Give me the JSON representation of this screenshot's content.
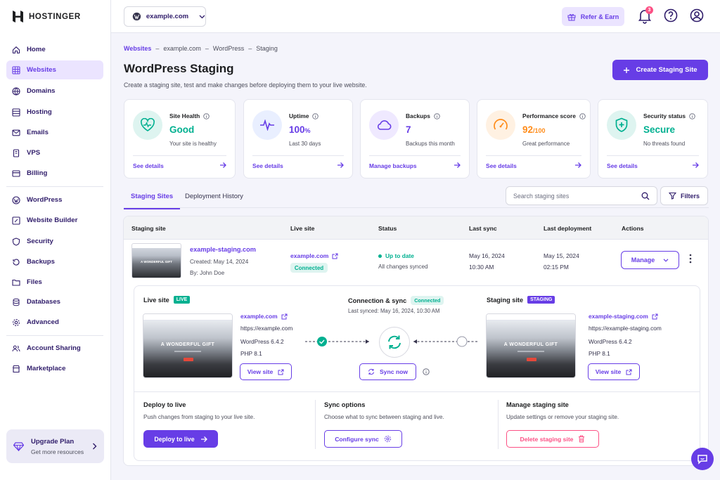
{
  "brand": {
    "name": "HOSTINGER"
  },
  "sidebar": {
    "items": [
      {
        "label": "Home",
        "icon": "home-icon"
      },
      {
        "label": "Websites",
        "icon": "websites-icon",
        "active": true
      },
      {
        "label": "Domains",
        "icon": "globe-icon"
      },
      {
        "label": "Hosting",
        "icon": "server-icon"
      },
      {
        "label": "Emails",
        "icon": "mail-icon"
      },
      {
        "label": "VPS",
        "icon": "vps-icon"
      },
      {
        "label": "Billing",
        "icon": "billing-icon"
      },
      {
        "label": "WordPress",
        "icon": "wordpress-icon"
      },
      {
        "label": "Website Builder",
        "icon": "builder-icon"
      },
      {
        "label": "Security",
        "icon": "shield-icon"
      },
      {
        "label": "Backups",
        "icon": "backup-icon"
      },
      {
        "label": "Files",
        "icon": "folder-icon"
      },
      {
        "label": "Databases",
        "icon": "database-icon"
      },
      {
        "label": "Advanced",
        "icon": "gear-icon"
      },
      {
        "label": "Account Sharing",
        "icon": "users-icon"
      },
      {
        "label": "Marketplace",
        "icon": "store-icon"
      }
    ],
    "upgrade": {
      "title": "Upgrade Plan",
      "subtitle": "Get more resources"
    }
  },
  "topbar": {
    "domain": "example.com",
    "refer_label": "Refer & Earn",
    "notification_count": "3"
  },
  "breadcrumb": {
    "root": "Websites",
    "domain": "example.com",
    "section": "WordPress",
    "page": "Staging",
    "separator": "–"
  },
  "page": {
    "title": "WordPress Staging",
    "subtitle": "Create a staging site, test and make changes before deploying them to your live website.",
    "create_button": "Create Staging Site"
  },
  "cards": [
    {
      "title": "Site Health",
      "value": "Good",
      "suffix": "",
      "sub": "Your site is healthy",
      "link": "See details",
      "color": "#00b090",
      "bg": "#def4f0"
    },
    {
      "title": "Uptime",
      "value": "100",
      "suffix": "%",
      "sub": "Last 30 days",
      "link": "See details",
      "color": "#673de6",
      "bg": "#e9efff"
    },
    {
      "title": "Backups",
      "value": "7",
      "suffix": "",
      "sub": "Backups this month",
      "link": "Manage backups",
      "color": "#673de6",
      "bg": "#efe9ff"
    },
    {
      "title": "Performance score",
      "value": "92",
      "suffix": "/100",
      "sub": "Great performance",
      "link": "See details",
      "color": "#ff8c1a",
      "bg": "#fff1e2"
    },
    {
      "title": "Security status",
      "value": "Secure",
      "suffix": "",
      "sub": "No threats found",
      "link": "See details",
      "color": "#00b090",
      "bg": "#def4f0"
    }
  ],
  "tabs": {
    "staging": "Staging Sites",
    "history": "Deployment History"
  },
  "search": {
    "placeholder": "Search staging sites"
  },
  "filters_label": "Filters",
  "table": {
    "headers": {
      "site": "Staging site",
      "live": "Live site",
      "status": "Status",
      "sync": "Last sync",
      "deploy": "Last deployment",
      "actions": "Actions"
    },
    "row": {
      "name": "example-staging.com",
      "created": "Created: May 14, 2024",
      "by": "By: John Doe",
      "live_site": "example.com",
      "live_badge": "Connected",
      "status": "Up to date",
      "status_sub": "All changes synced",
      "last_sync_date": "May 16, 2024",
      "last_sync_time": "10:30 AM",
      "last_deploy_date": "May 15, 2024",
      "last_deploy_time": "02:15 PM",
      "manage_label": "Manage"
    }
  },
  "detail": {
    "live": {
      "title": "Live site",
      "tag": "LIVE",
      "domain": "example.com",
      "url": "https://example.com",
      "wp": "WordPress 6.4.2",
      "php": "PHP 8.1",
      "button": "View site",
      "hero": "A WONDERFUL GIFT"
    },
    "connection": {
      "title": "Connection & sync",
      "badge": "Connected",
      "last_synced": "Last synced: May 16, 2024, 10:30 AM",
      "sync_button": "Sync now"
    },
    "staging": {
      "title": "Staging site",
      "tag": "STAGING",
      "domain": "example-staging.com",
      "url": "https://example-staging.com",
      "wp": "WordPress 6.4.2",
      "php": "PHP 8.1",
      "button": "View site",
      "hero": "A WONDERFUL GIFT"
    },
    "actions": [
      {
        "title": "Deploy to live",
        "desc": "Push changes from staging to your live site.",
        "button": "Deploy to live"
      },
      {
        "title": "Sync options",
        "desc": "Choose what to sync between staging and live.",
        "button": "Configure sync"
      },
      {
        "title": "Manage staging site",
        "desc": "Update settings or remove your staging site.",
        "button": "Delete staging site"
      }
    ]
  },
  "colors": {
    "primary": "#673de6",
    "success": "#00b090",
    "danger": "#fc5185",
    "warning": "#ff8c1a"
  }
}
